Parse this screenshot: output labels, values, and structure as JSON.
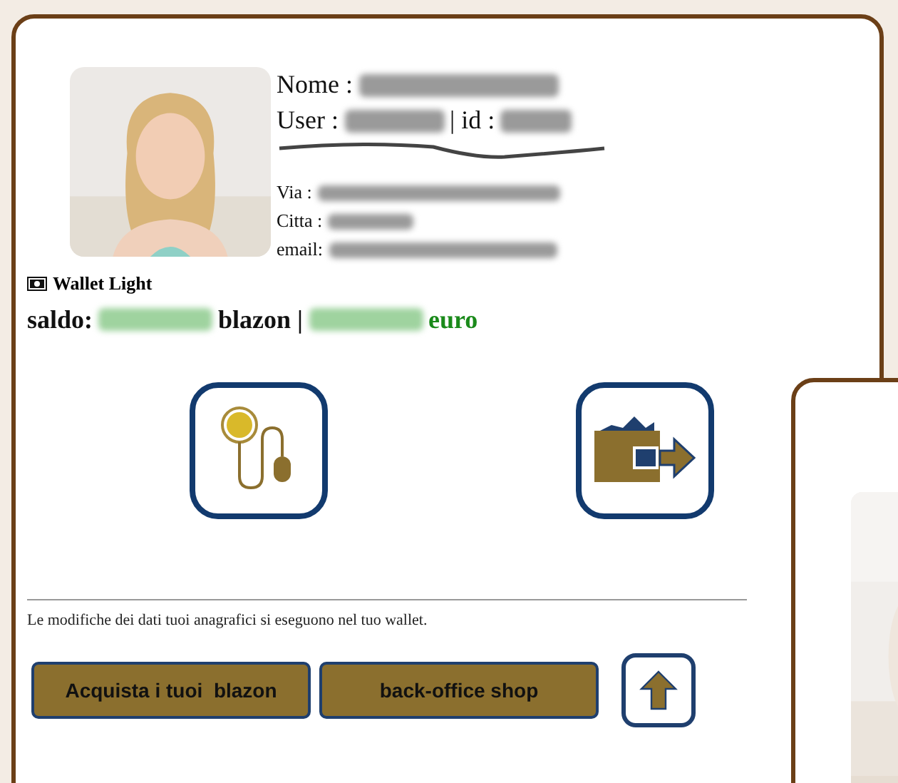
{
  "profile": {
    "header_rows": [
      {
        "parts": [
          {
            "kind": "text",
            "text": "Nome :"
          },
          {
            "kind": "blur",
            "color": "#9a9a9a"
          }
        ]
      },
      {
        "parts": [
          {
            "kind": "text",
            "text": "User :"
          },
          {
            "kind": "blur",
            "color": "#9a9a9a"
          },
          {
            "kind": "text",
            "text": "| id :"
          },
          {
            "kind": "blur",
            "color": "#9a9a9a"
          }
        ]
      }
    ],
    "address_rows": [
      {
        "parts": [
          {
            "kind": "text",
            "text": "Via :"
          },
          {
            "kind": "blur",
            "color": "#9a9a9a"
          }
        ]
      },
      {
        "parts": [
          {
            "kind": "text",
            "text": "Citta :"
          },
          {
            "kind": "blur",
            "color": "#9a9a9a"
          }
        ]
      },
      {
        "parts": [
          {
            "kind": "text",
            "text": "email:"
          },
          {
            "kind": "blur",
            "color": "#9a9a9a"
          }
        ]
      }
    ]
  },
  "wallet": {
    "title": "Wallet Light",
    "balance": [
      {
        "kind": "text",
        "text": "saldo:",
        "color": "#111111"
      },
      {
        "kind": "blur",
        "color": "#9fd39f"
      },
      {
        "kind": "text",
        "text": "blazon |",
        "color": "#111111"
      },
      {
        "kind": "blur",
        "color": "#9fd39f"
      },
      {
        "kind": "text",
        "text": "euro",
        "color": "#1a8a1a"
      }
    ]
  },
  "actions": [
    {
      "kind": "coin-mouse"
    },
    {
      "kind": "wallet-export"
    }
  ],
  "note": "Le modifiche dei dati tuoi anagrafici si eseguono nel tuo wallet.",
  "buttons": [
    {
      "label": "Acquista i tuoi  blazon"
    },
    {
      "label": "back-office shop"
    }
  ]
}
